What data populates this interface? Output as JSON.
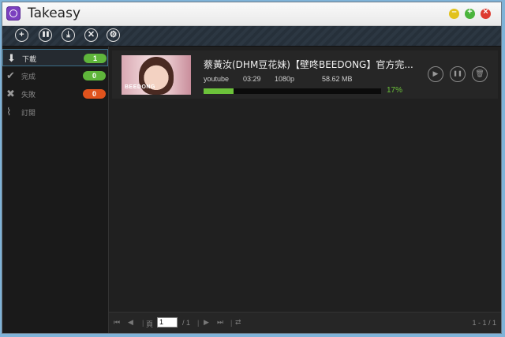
{
  "app": {
    "title": "Takeasy"
  },
  "toolbar": {
    "buttons": [
      {
        "icon": "plus-icon",
        "glyph": "+"
      },
      {
        "icon": "pause-all-icon",
        "glyph": "❚❚"
      },
      {
        "icon": "download-icon",
        "glyph": "⤓"
      },
      {
        "icon": "cancel-icon",
        "glyph": "✕"
      },
      {
        "icon": "settings-icon",
        "glyph": "⚙"
      }
    ]
  },
  "sidebar": {
    "items": [
      {
        "label": "下載",
        "count": "1",
        "icon": "download-tray-icon",
        "color": "#5fb53b"
      },
      {
        "label": "完成",
        "count": "0",
        "icon": "check-icon",
        "color": "#5fb53b"
      },
      {
        "label": "失敗",
        "count": "0",
        "icon": "x-icon",
        "color": "#e0531d"
      },
      {
        "label": "訂閱",
        "count": "",
        "icon": "rss-icon",
        "color": ""
      }
    ]
  },
  "download": {
    "title": "蔡黃汝(DHM豆花妹)【壁咚BEEDONG】官方完...",
    "source": "youtube",
    "duration": "03:29",
    "quality": "1080p",
    "size": "58.62 MB",
    "progress": "17%",
    "progress_value": 0.17,
    "thumb_text": "BEEDONG"
  },
  "pager": {
    "page_label": "頁",
    "current_page": "1",
    "total": "/ 1",
    "range": "1 - 1 / 1"
  },
  "colors": {
    "accent": "#6cc23a",
    "danger": "#e0531d"
  }
}
